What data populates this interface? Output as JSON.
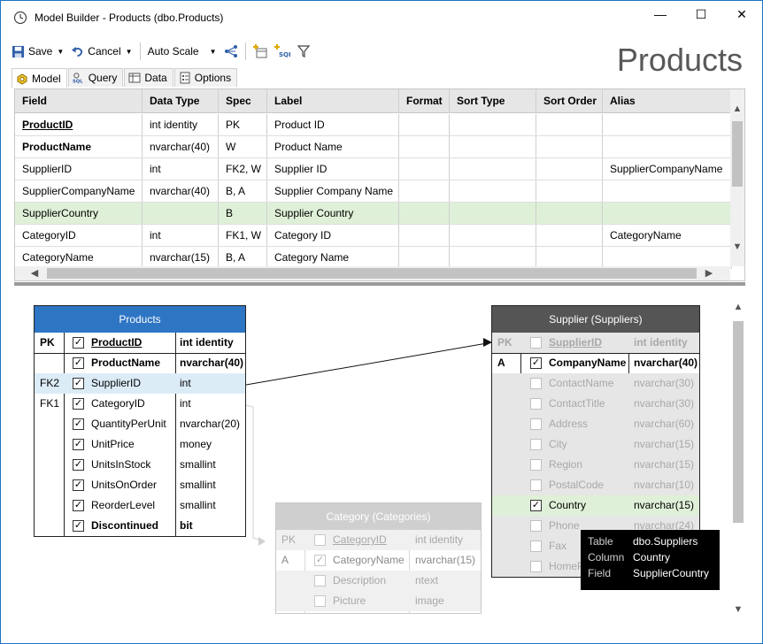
{
  "window": {
    "title": "Model Builder - Products (dbo.Products)",
    "minimize": "—",
    "maximize": "☐",
    "close": "✕"
  },
  "toolbar": {
    "save_label": "Save",
    "cancel_label": "Cancel",
    "autoscale_label": "Auto Scale"
  },
  "page_title": "Products",
  "tabs": [
    {
      "label": "Model"
    },
    {
      "label": "Query"
    },
    {
      "label": "Data"
    },
    {
      "label": "Options"
    }
  ],
  "grid": {
    "headers": [
      "Field",
      "Data Type",
      "Spec",
      "Label",
      "Format",
      "Sort Type",
      "Sort Order",
      "Alias"
    ],
    "rows": [
      [
        "ProductID",
        "int identity",
        "PK",
        "Product ID",
        "",
        "",
        "",
        ""
      ],
      [
        "ProductName",
        "nvarchar(40)",
        "W",
        "Product Name",
        "",
        "",
        "",
        ""
      ],
      [
        "SupplierID",
        "int",
        "FK2, W",
        "Supplier ID",
        "",
        "",
        "",
        "SupplierCompanyName"
      ],
      [
        "SupplierCompanyName",
        "nvarchar(40)",
        "B, A",
        "Supplier Company Name",
        "",
        "",
        "",
        ""
      ],
      [
        "SupplierCountry",
        "",
        "B",
        "Supplier Country",
        "",
        "",
        "",
        ""
      ],
      [
        "CategoryID",
        "int",
        "FK1, W",
        "Category ID",
        "",
        "",
        "",
        "CategoryName"
      ],
      [
        "CategoryName",
        "nvarchar(15)",
        "B, A",
        "Category Name",
        "",
        "",
        "",
        ""
      ]
    ]
  },
  "products_entity": {
    "title": "Products",
    "rows": [
      {
        "key": "PK",
        "checked": true,
        "name": "ProductID",
        "type": "int identity"
      },
      {
        "key": "",
        "checked": true,
        "name": "ProductName",
        "type": "nvarchar(40)"
      },
      {
        "key": "FK2",
        "checked": true,
        "name": "SupplierID",
        "type": "int"
      },
      {
        "key": "FK1",
        "checked": true,
        "name": "CategoryID",
        "type": "int"
      },
      {
        "key": "",
        "checked": true,
        "name": "QuantityPerUnit",
        "type": "nvarchar(20)"
      },
      {
        "key": "",
        "checked": true,
        "name": "UnitPrice",
        "type": "money"
      },
      {
        "key": "",
        "checked": true,
        "name": "UnitsInStock",
        "type": "smallint"
      },
      {
        "key": "",
        "checked": true,
        "name": "UnitsOnOrder",
        "type": "smallint"
      },
      {
        "key": "",
        "checked": true,
        "name": "ReorderLevel",
        "type": "smallint"
      },
      {
        "key": "",
        "checked": true,
        "name": "Discontinued",
        "type": "bit"
      }
    ]
  },
  "supplier_entity": {
    "title": "Supplier (Suppliers)",
    "rows": [
      {
        "key": "PK",
        "checked": false,
        "name": "SupplierID",
        "type": "int identity"
      },
      {
        "key": "A",
        "checked": true,
        "name": "CompanyName",
        "type": "nvarchar(40)"
      },
      {
        "key": "",
        "checked": false,
        "name": "ContactName",
        "type": "nvarchar(30)"
      },
      {
        "key": "",
        "checked": false,
        "name": "ContactTitle",
        "type": "nvarchar(30)"
      },
      {
        "key": "",
        "checked": false,
        "name": "Address",
        "type": "nvarchar(60)"
      },
      {
        "key": "",
        "checked": false,
        "name": "City",
        "type": "nvarchar(15)"
      },
      {
        "key": "",
        "checked": false,
        "name": "Region",
        "type": "nvarchar(15)"
      },
      {
        "key": "",
        "checked": false,
        "name": "PostalCode",
        "type": "nvarchar(10)"
      },
      {
        "key": "",
        "checked": true,
        "name": "Country",
        "type": "nvarchar(15)"
      },
      {
        "key": "",
        "checked": false,
        "name": "Phone",
        "type": "nvarchar(24)"
      },
      {
        "key": "",
        "checked": false,
        "name": "Fax",
        "type": "nvarchar(24)"
      },
      {
        "key": "",
        "checked": false,
        "name": "HomePage",
        "type": "ntext"
      }
    ]
  },
  "category_entity": {
    "title": "Category (Categories)",
    "rows": [
      {
        "key": "PK",
        "checked": false,
        "name": "CategoryID",
        "type": "int identity"
      },
      {
        "key": "A",
        "checked": true,
        "name": "CategoryName",
        "type": "nvarchar(15)"
      },
      {
        "key": "",
        "checked": false,
        "name": "Description",
        "type": "ntext"
      },
      {
        "key": "",
        "checked": false,
        "name": "Picture",
        "type": "image"
      }
    ]
  },
  "tooltip": {
    "table_label": "Table",
    "table_value": "dbo.Suppliers",
    "column_label": "Column",
    "column_value": "Country",
    "field_label": "Field",
    "field_value": "SupplierCountry"
  },
  "colors": {
    "products_header": "#2e75c4",
    "supplier_header": "#555555",
    "category_header": "#cfcfcf",
    "selected_row": "#dff0d8",
    "highlight_row": "#dcecf7"
  }
}
